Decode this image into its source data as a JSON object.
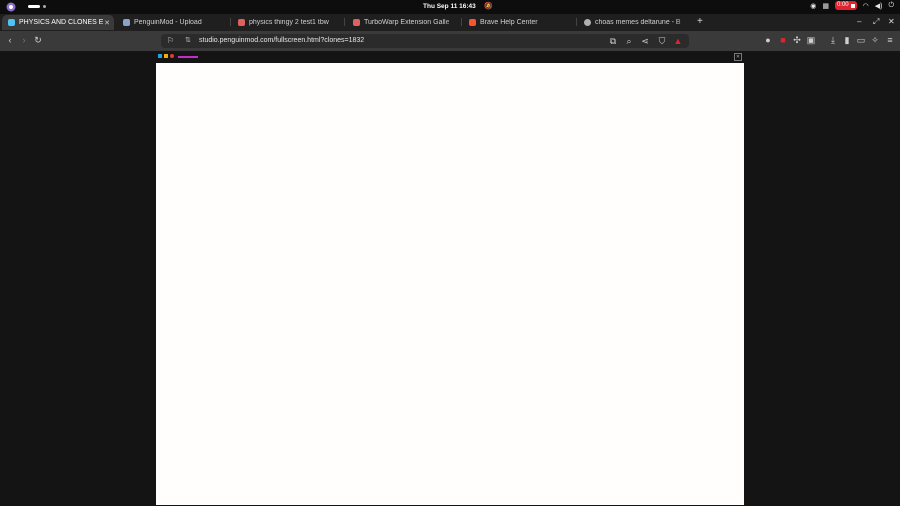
{
  "system_bar": {
    "clock": "Thu Sep 11  16:43",
    "recording_time": "0:00"
  },
  "tabs": [
    {
      "title": "PHYSICS AND CLONES E",
      "active": true,
      "favicon_color": "#4fc3f7"
    },
    {
      "title": "PenguinMod - Upload",
      "active": false,
      "favicon_color": "#8aa4c8"
    },
    {
      "title": "physics thingy 2 test1 tbw",
      "active": false,
      "favicon_color": "#e06060"
    },
    {
      "title": "TurboWarp Extension Galle",
      "active": false,
      "favicon_color": "#e06060"
    },
    {
      "title": "Brave Help Center",
      "active": false,
      "favicon_color": "#fb542b"
    },
    {
      "title": "choas memes deltarune - B",
      "active": false,
      "favicon_color": "#b0b0b0"
    }
  ],
  "toolbar": {
    "url": "studio.penguinmod.com/fullscreen.html?clones=1832"
  },
  "colors": {
    "accent_red": "#e0242f",
    "stage_bg": "#fffefc",
    "page_bg": "#141414"
  }
}
